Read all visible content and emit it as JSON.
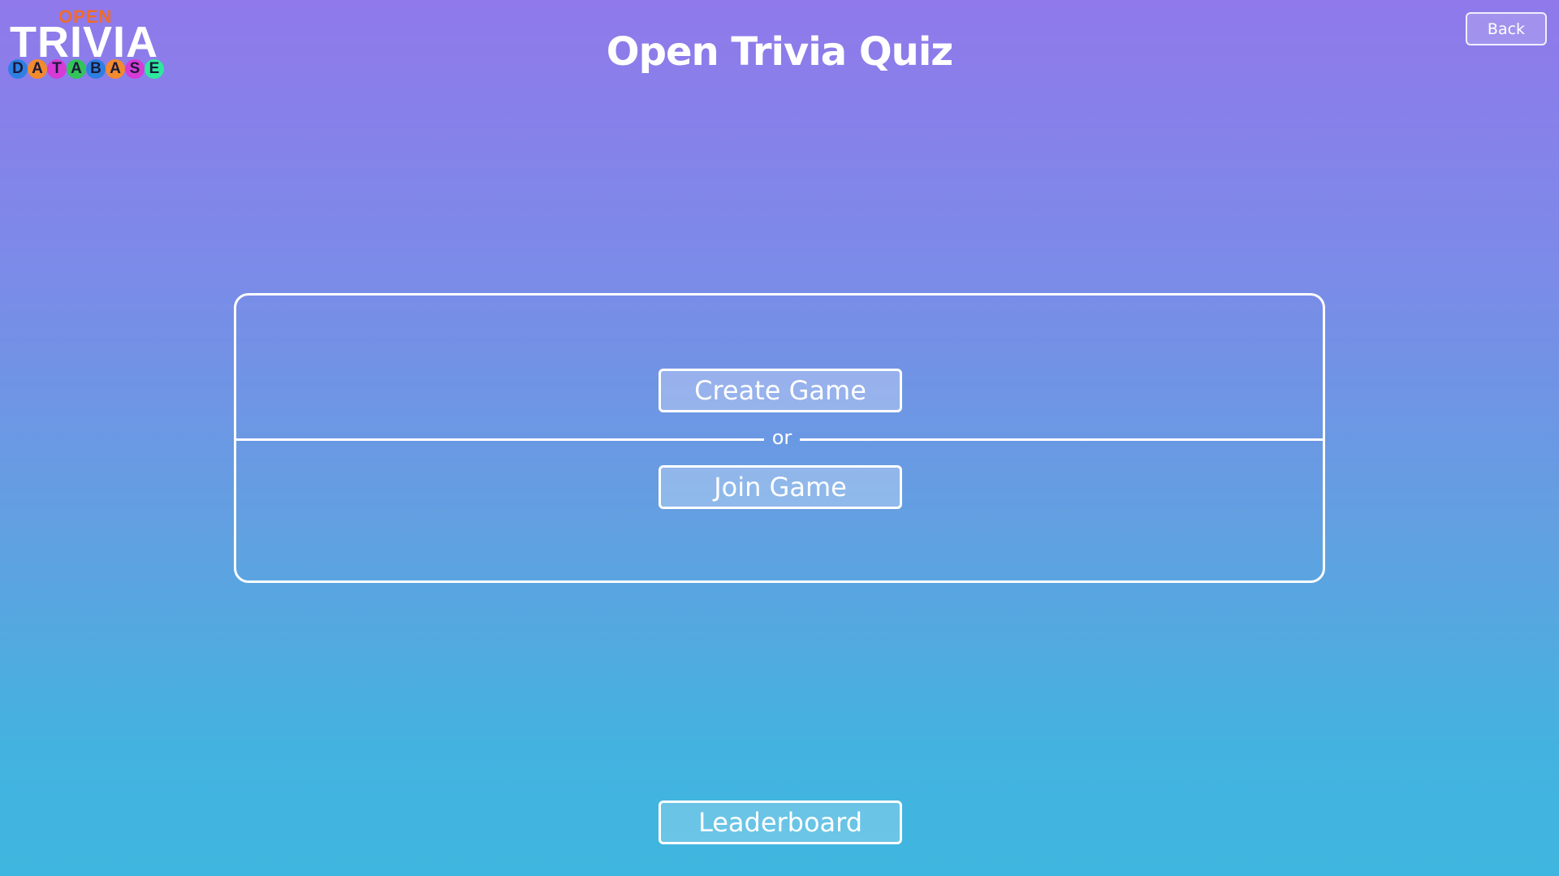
{
  "logo": {
    "open": "OPEN",
    "trivia": "TRIVIA",
    "database_letters": [
      {
        "char": "D",
        "color": "#2f7fe3"
      },
      {
        "char": "A",
        "color": "#f28a2e"
      },
      {
        "char": "T",
        "color": "#d63bd6"
      },
      {
        "char": "A",
        "color": "#33c45a"
      },
      {
        "char": "B",
        "color": "#2f7fe3"
      },
      {
        "char": "A",
        "color": "#f28a2e"
      },
      {
        "char": "S",
        "color": "#d63bd6"
      },
      {
        "char": "E",
        "color": "#2ee89e"
      }
    ]
  },
  "header": {
    "title": "Open Trivia Quiz",
    "back_label": "Back"
  },
  "panel": {
    "create_label": "Create Game",
    "or_label": "or",
    "join_label": "Join Game"
  },
  "footer": {
    "leaderboard_label": "Leaderboard"
  },
  "colors": {
    "gradient_top": "#9079eb",
    "gradient_bottom": "#3fb6df",
    "logo_open": "#ef6b2c"
  }
}
